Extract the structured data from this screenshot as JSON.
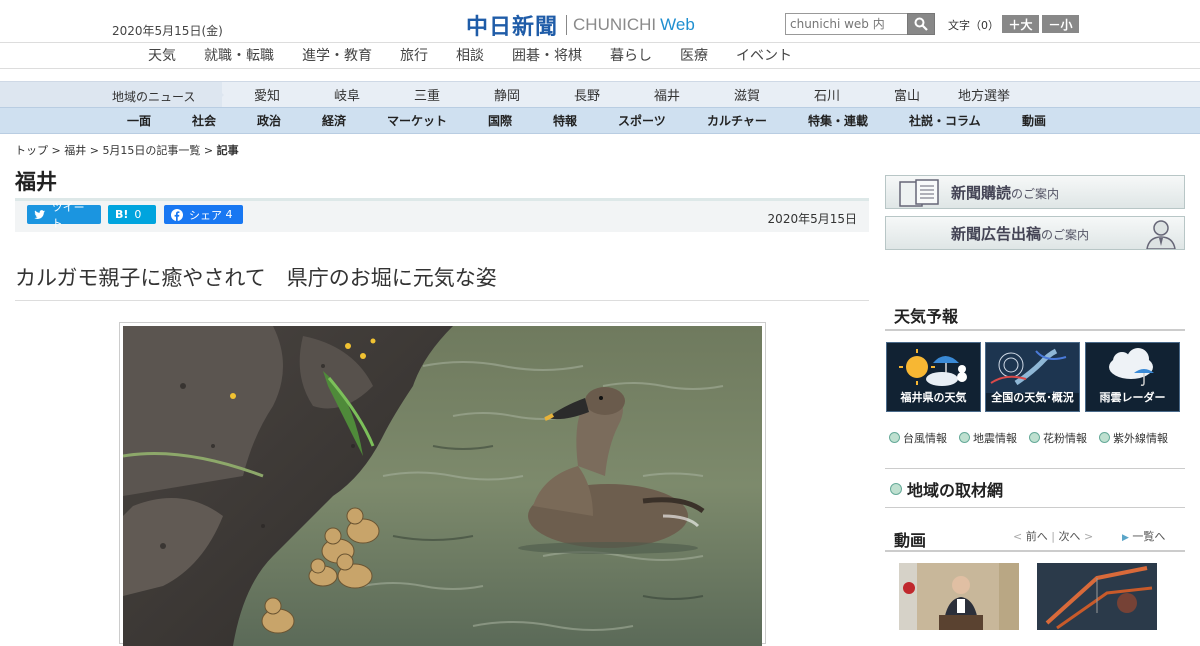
{
  "header": {
    "date": "2020年5月15日(金)",
    "logo_jp": "中日新聞",
    "logo_en": "CHUNICHI",
    "logo_web": "Web",
    "search_placeholder": "chunichi web 内",
    "font_label": "文字（0）",
    "font_larger": "＋大",
    "font_smaller": "－小"
  },
  "nav_top": [
    "天気",
    "就職・転職",
    "進学・教育",
    "旅行",
    "相談",
    "囲碁・将棋",
    "暮らし",
    "医療",
    "イベント"
  ],
  "region_nav": {
    "label": "地域のニュース",
    "items": [
      "愛知",
      "岐阜",
      "三重",
      "静岡",
      "長野",
      "福井",
      "滋賀",
      "石川",
      "富山",
      "地方選挙"
    ]
  },
  "nav_main": [
    "一面",
    "社会",
    "政治",
    "経済",
    "マーケット",
    "国際",
    "特報",
    "スポーツ",
    "カルチャー",
    "特集・連載",
    "社説・コラム",
    "動画"
  ],
  "breadcrumb": {
    "items": [
      "トップ",
      "福井",
      "5月15日の記事一覧"
    ],
    "separator": " > ",
    "current": "記事"
  },
  "section_title": "福井",
  "share": {
    "tweet": "ツイート",
    "hatena_icon": "B!",
    "hatena_count": "0",
    "fb_share": "シェア",
    "fb_count": "4"
  },
  "article": {
    "date": "2020年5月15日",
    "headline": "カルガモ親子に癒やされて　県庁のお堀に元気な姿"
  },
  "sidebar": {
    "banner1_main": "新聞購読",
    "banner1_sub": "のご案内",
    "banner2_main": "新聞広告出稿",
    "banner2_sub": "のご案内",
    "weather_heading": "天気予報",
    "weather_tiles": [
      "福井県の天気",
      "全国の天気･概況",
      "雨雲レーダー"
    ],
    "weather_links": [
      "台風情報",
      "地震情報",
      "花粉情報",
      "紫外線情報"
    ],
    "area_network": "地域の取材網",
    "video_heading": "動画",
    "video_prev": "前へ",
    "video_next": "次へ",
    "video_all": "一覧へ"
  },
  "colors": {
    "brand_blue": "#1f5ca8",
    "twitter": "#1b95e0",
    "hatena": "#00a4de",
    "facebook": "#1877f2",
    "nav_main_bg": "#cfe0f0"
  }
}
